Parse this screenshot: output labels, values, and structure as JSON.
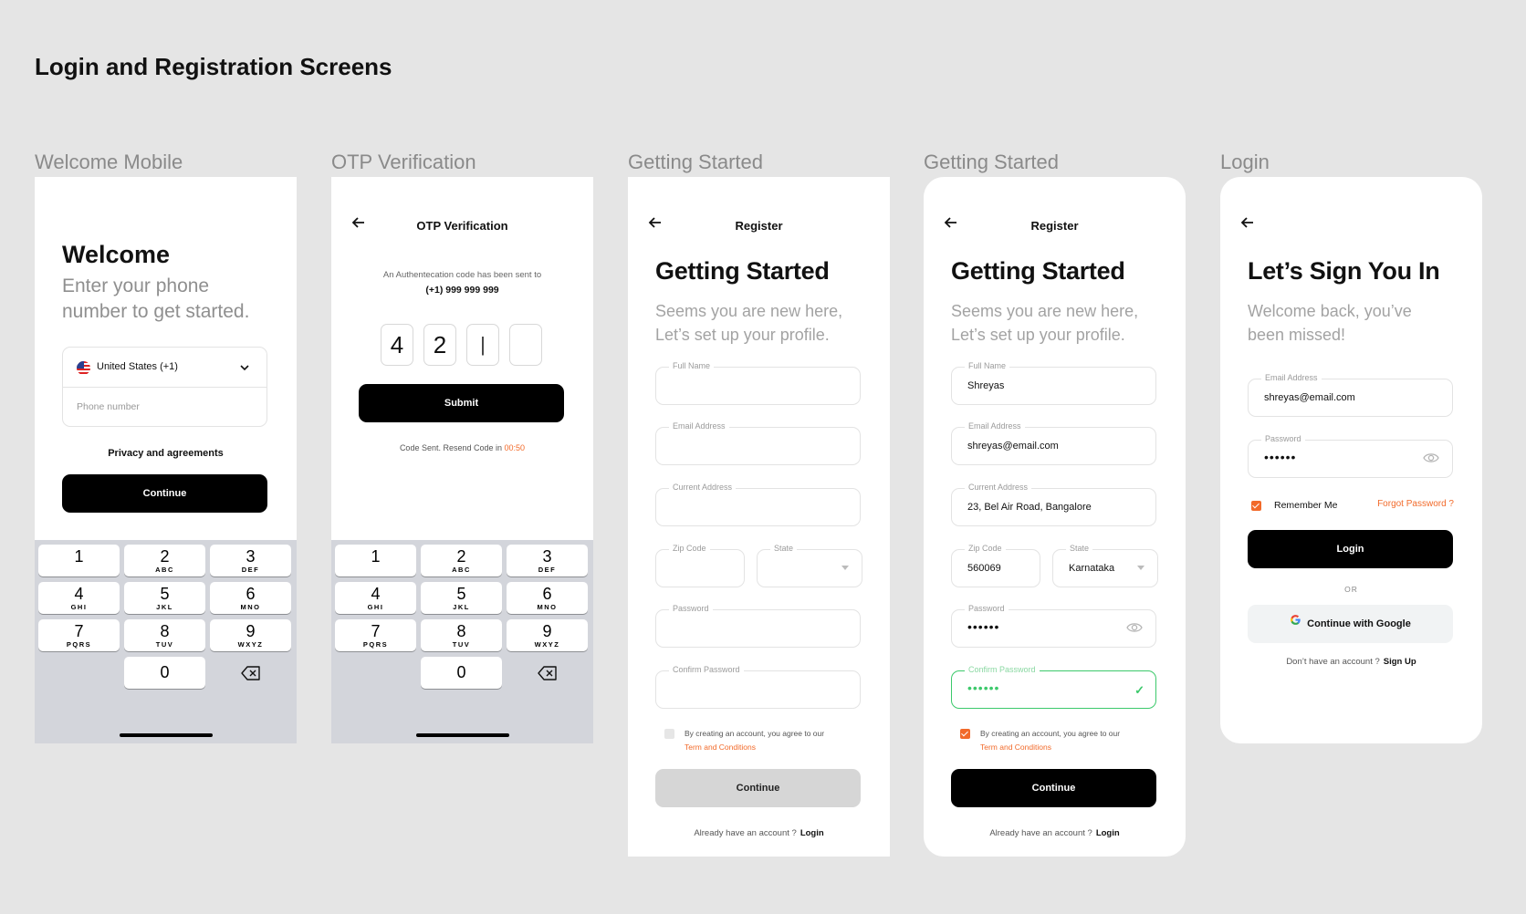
{
  "page_title": "Login and Registration Screens",
  "screens": {
    "welcome": {
      "label": "Welcome Mobile",
      "title": "Welcome",
      "subtitle_1": "Enter your phone",
      "subtitle_2": "number to get started.",
      "country": "United States (+1)",
      "phone_placeholder": "Phone number",
      "privacy": "Privacy and agreements",
      "continue": "Continue"
    },
    "otp": {
      "label": "OTP Verification",
      "nav_title": "OTP Verification",
      "message": "An Authentecation code has been sent to",
      "phone": "(+1) 999 999 999",
      "digits": [
        "4",
        "2",
        "|",
        ""
      ],
      "submit": "Submit",
      "resend_text": "Code Sent. Resend Code in",
      "timer": "00:50"
    },
    "register_empty": {
      "label": "Getting Started",
      "nav_title": "Register",
      "title": "Getting Started",
      "subtitle_1": "Seems you are new here,",
      "subtitle_2": "Let’s set up your profile.",
      "full_name_label": "Full Name",
      "email_label": "Email Address",
      "address_label": "Current Address",
      "zip_label": "Zip Code",
      "state_label": "State",
      "password_label": "Password",
      "confirm_label": "Confirm Password",
      "terms_text": "By creating an account, you agree to our",
      "terms_link": "Term and Conditions",
      "continue": "Continue",
      "footer_text": "Already have an account ?",
      "footer_link": "Login"
    },
    "register_filled": {
      "label": "Getting Started",
      "nav_title": "Register",
      "title": "Getting Started",
      "subtitle_1": "Seems you are new here,",
      "subtitle_2": "Let’s set up your profile.",
      "full_name_label": "Full Name",
      "full_name": "Shreyas",
      "email_label": "Email Address",
      "email": "shreyas@email.com",
      "address_label": "Current Address",
      "address": "23, Bel Air Road, Bangalore",
      "zip_label": "Zip Code",
      "zip": "560069",
      "state_label": "State",
      "state": "Karnataka",
      "password_label": "Password",
      "password_mask": "••••••",
      "confirm_label": "Confirm Password",
      "confirm_mask": "••••••",
      "terms_text": "By creating an account, you agree to our",
      "terms_link": "Term and Conditions",
      "continue": "Continue",
      "footer_text": "Already have an account ?",
      "footer_link": "Login"
    },
    "login": {
      "label": "Login",
      "title": "Let’s Sign You In",
      "subtitle_1": "Welcome back, you’ve",
      "subtitle_2": "been missed!",
      "email_label": "Email Address",
      "email": "shreyas@email.com",
      "password_label": "Password",
      "password_mask": "••••••",
      "remember": "Remember Me",
      "forgot": "Forgot Password ?",
      "login_button": "Login",
      "or": "OR",
      "google": "Continue with Google",
      "footer_text": "Don’t have an account ?",
      "footer_link": "Sign Up"
    }
  },
  "keyboard": {
    "keys": [
      {
        "n": "1",
        "l": ""
      },
      {
        "n": "2",
        "l": "ABC"
      },
      {
        "n": "3",
        "l": "DEF"
      },
      {
        "n": "4",
        "l": "GHI"
      },
      {
        "n": "5",
        "l": "JKL"
      },
      {
        "n": "6",
        "l": "MNO"
      },
      {
        "n": "7",
        "l": "PQRS"
      },
      {
        "n": "8",
        "l": "TUV"
      },
      {
        "n": "9",
        "l": "WXYZ"
      },
      {
        "n": "0",
        "l": ""
      }
    ]
  },
  "colors": {
    "accent": "#f26a2a",
    "success": "#3cc96b",
    "background": "#e5e5e5",
    "primary_button": "#000000"
  }
}
